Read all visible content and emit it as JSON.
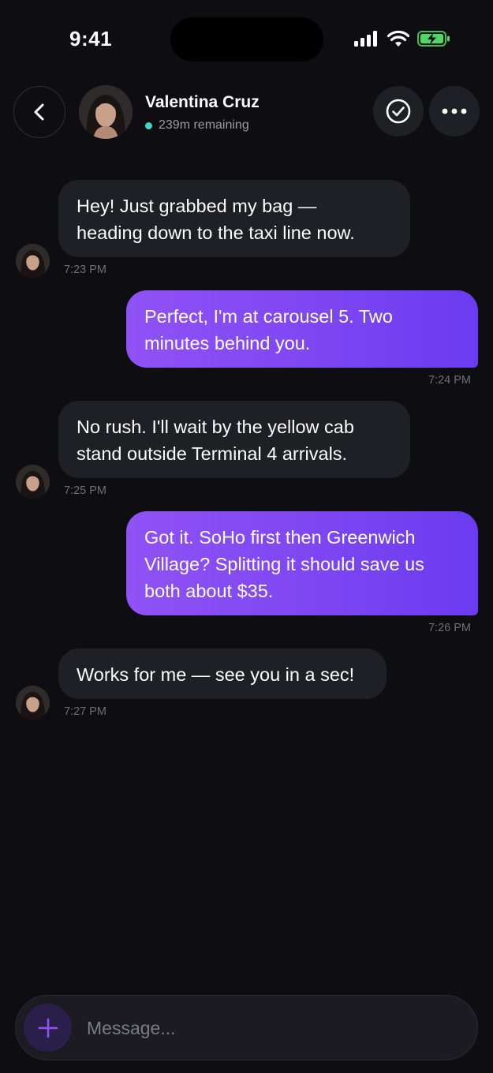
{
  "status_bar": {
    "time": "9:41"
  },
  "header": {
    "contact_name": "Valentina Cruz",
    "presence_text": "239m remaining",
    "back_icon": "chevron-left-icon",
    "check_icon": "check-circle-icon",
    "more_icon": "ellipsis-icon"
  },
  "messages": [
    {
      "direction": "incoming",
      "lines": [
        "Hey! Just grabbed my bag —",
        "heading down to the taxi line now."
      ],
      "time": "7:23 PM"
    },
    {
      "direction": "outgoing",
      "lines": [
        "Perfect, I'm at carousel 5. Two",
        "minutes behind you."
      ],
      "time": "7:24 PM"
    },
    {
      "direction": "incoming",
      "lines": [
        "No rush. I'll wait by the yellow cab",
        "stand outside Terminal 4 arrivals."
      ],
      "time": "7:25 PM"
    },
    {
      "direction": "outgoing",
      "lines": [
        "Got it. SoHo first then Greenwich",
        "Village? Splitting it should save us",
        "both about $35."
      ],
      "time": "7:26 PM"
    },
    {
      "direction": "incoming",
      "lines": [
        "Works for me — see you in a sec!"
      ],
      "time": "7:27 PM"
    }
  ],
  "composer": {
    "placeholder": "Message...",
    "value": "",
    "add_icon": "plus-icon"
  },
  "colors": {
    "background": "#0d0d12",
    "incoming_bubble": "#1f1f26",
    "outgoing_bubble_start": "#8f52f5",
    "outgoing_bubble_end": "#6a3bf0",
    "presence": "#3fd6c8",
    "battery": "#4cd964"
  }
}
